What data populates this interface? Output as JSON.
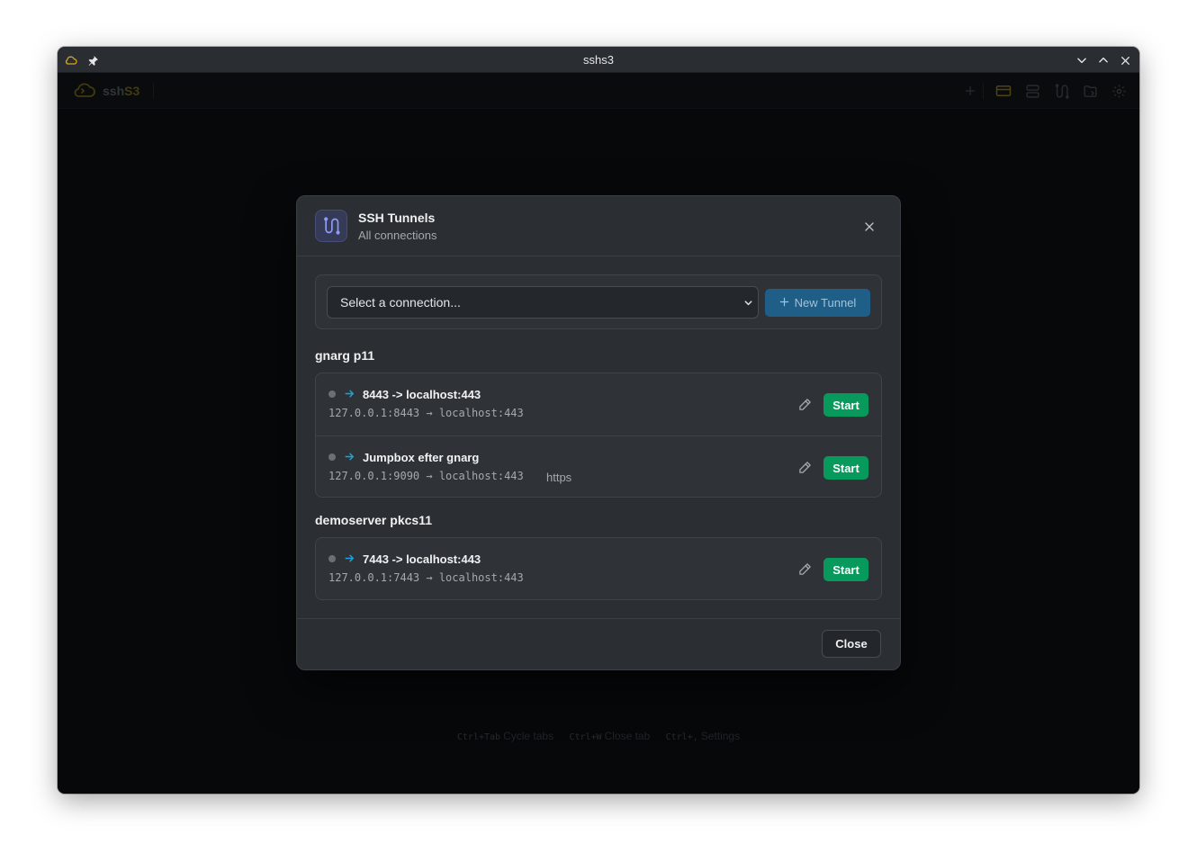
{
  "window": {
    "title": "sshs3",
    "icons": {
      "app": "cloud-icon",
      "pin": "pin-icon",
      "minimize": "chevron-down-icon",
      "maximize": "chevron-up-icon",
      "close": "close-icon"
    }
  },
  "appbar": {
    "brand_prefix": "ssh",
    "brand_suffix": "S3",
    "icons": [
      "plus-icon",
      "card-icon",
      "servers-icon",
      "tunnel-icon",
      "folder-sync-icon",
      "settings-icon"
    ]
  },
  "shortcuts": [
    {
      "key": "Ctrl+Tab",
      "label": "Cycle tabs"
    },
    {
      "key": "Ctrl+W",
      "label": "Close tab"
    },
    {
      "key": "Ctrl+,",
      "label": "Settings"
    }
  ],
  "modal": {
    "title": "SSH Tunnels",
    "subtitle": "All connections",
    "select_placeholder": "Select a connection...",
    "new_tunnel_label": "New Tunnel",
    "close_label": "Close",
    "groups": [
      {
        "name": "gnarg p11",
        "tunnels": [
          {
            "name": "8443 -> localhost:443",
            "route": "127.0.0.1:8443 → localhost:443",
            "tag": "",
            "action": "Start"
          },
          {
            "name": "Jumpbox efter gnarg",
            "route": "127.0.0.1:9090 → localhost:443",
            "tag": "https",
            "action": "Start"
          }
        ]
      },
      {
        "name": "demoserver pkcs11",
        "tunnels": [
          {
            "name": "7443 -> localhost:443",
            "route": "127.0.0.1:7443 → localhost:443",
            "tag": "",
            "action": "Start"
          }
        ]
      }
    ]
  },
  "colors": {
    "accent_yellow": "#c9a227",
    "start_green": "#079a5c",
    "new_tunnel_blue": "#1f5e86",
    "arrow_cyan": "#1fa3d6"
  }
}
